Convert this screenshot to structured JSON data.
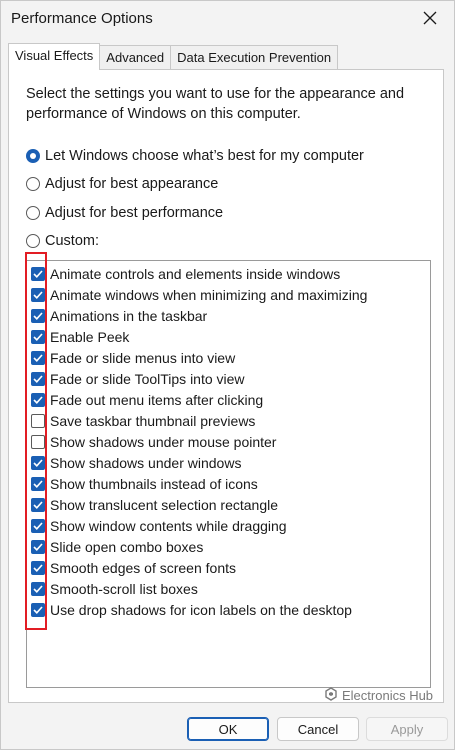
{
  "window": {
    "title": "Performance Options",
    "close_icon": "close-icon"
  },
  "tabs": [
    {
      "label": "Visual Effects",
      "active": true
    },
    {
      "label": "Advanced",
      "active": false
    },
    {
      "label": "Data Execution Prevention",
      "active": false
    }
  ],
  "description": "Select the settings you want to use for the appearance and performance of Windows on this computer.",
  "radios": [
    {
      "label": "Let Windows choose what’s best for my computer",
      "checked": true
    },
    {
      "label": "Adjust for best appearance",
      "checked": false
    },
    {
      "label": "Adjust for best performance",
      "checked": false
    },
    {
      "label": "Custom:",
      "checked": false
    }
  ],
  "effects": [
    {
      "label": "Animate controls and elements inside windows",
      "checked": true
    },
    {
      "label": "Animate windows when minimizing and maximizing",
      "checked": true
    },
    {
      "label": "Animations in the taskbar",
      "checked": true
    },
    {
      "label": "Enable Peek",
      "checked": true
    },
    {
      "label": "Fade or slide menus into view",
      "checked": true
    },
    {
      "label": "Fade or slide ToolTips into view",
      "checked": true
    },
    {
      "label": "Fade out menu items after clicking",
      "checked": true
    },
    {
      "label": "Save taskbar thumbnail previews",
      "checked": false
    },
    {
      "label": "Show shadows under mouse pointer",
      "checked": false
    },
    {
      "label": "Show shadows under windows",
      "checked": true
    },
    {
      "label": "Show thumbnails instead of icons",
      "checked": true
    },
    {
      "label": "Show translucent selection rectangle",
      "checked": true
    },
    {
      "label": "Show window contents while dragging",
      "checked": true
    },
    {
      "label": "Slide open combo boxes",
      "checked": true
    },
    {
      "label": "Smooth edges of screen fonts",
      "checked": true
    },
    {
      "label": "Smooth-scroll list boxes",
      "checked": true
    },
    {
      "label": "Use drop shadows for icon labels on the desktop",
      "checked": true
    }
  ],
  "watermark": "Electronics Hub",
  "buttons": {
    "ok": "OK",
    "cancel": "Cancel",
    "apply": "Apply"
  },
  "colors": {
    "accent": "#1a5fb4",
    "highlight_box": "#e21d24"
  }
}
